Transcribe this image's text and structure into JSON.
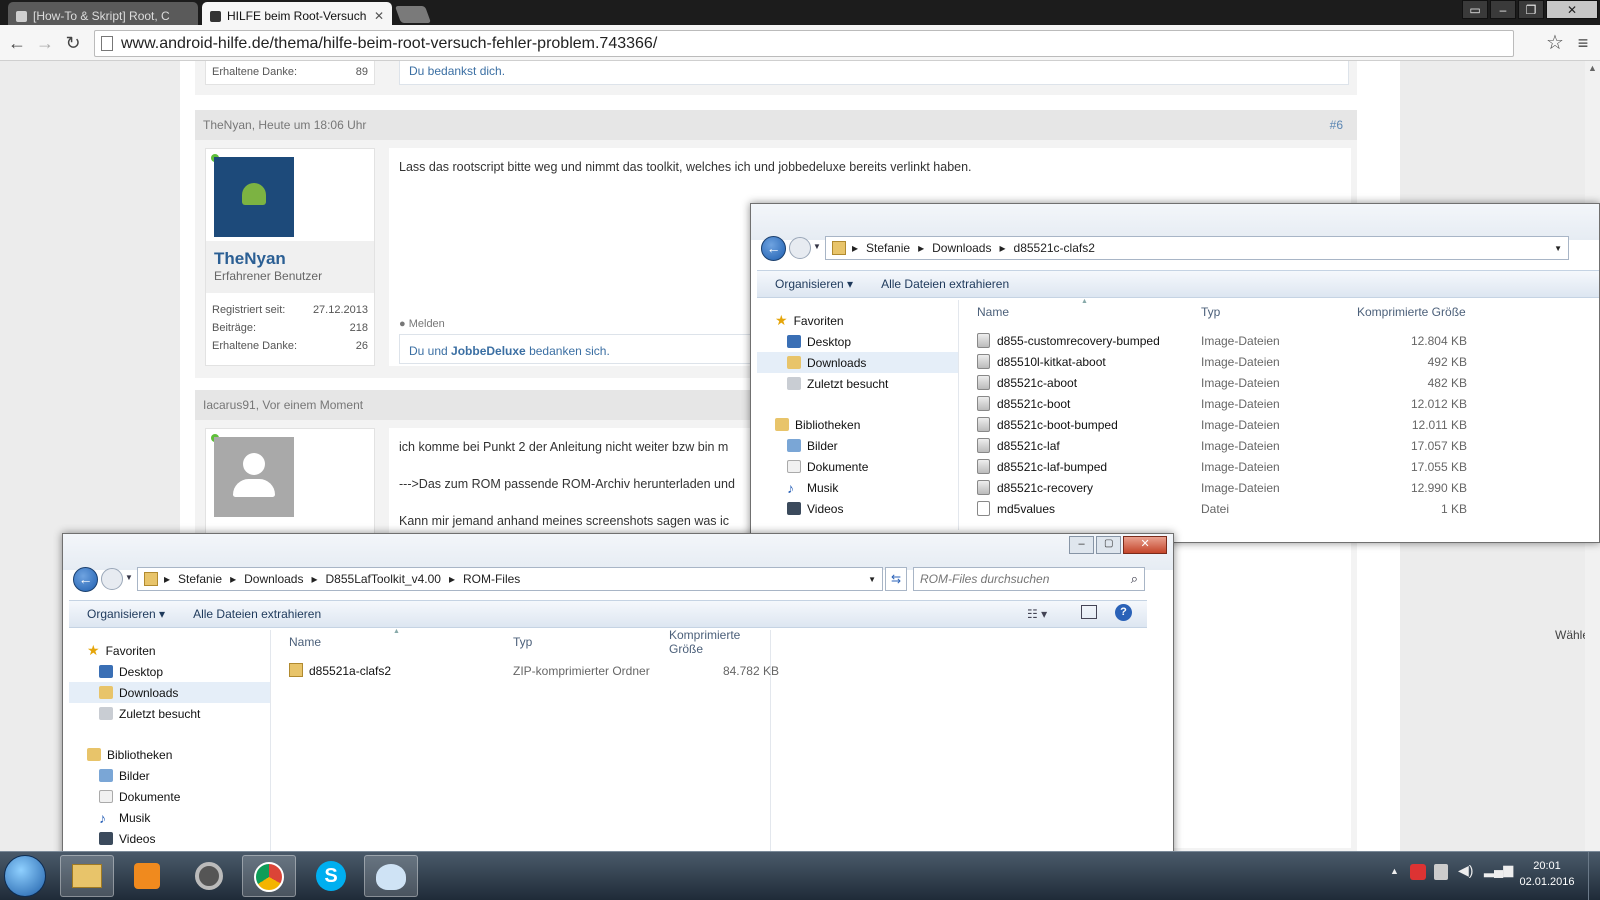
{
  "browser": {
    "tabs": [
      {
        "label": "[How-To & Skript] Root, C",
        "active": false
      },
      {
        "label": "HILFE beim Root-Versuch",
        "active": true
      }
    ],
    "url": "www.android-hilfe.de/thema/hilfe-beim-root-versuch-fehler-problem.743366/"
  },
  "forum": {
    "prev_post": {
      "thanks_label": "Erhaltene Danke:",
      "thanks_value": "89",
      "thanks_text": "Du bedankst dich."
    },
    "post6": {
      "header": "TheNyan, Heute um 18:06 Uhr",
      "number": "#6",
      "username": "TheNyan",
      "role": "Erfahrener Benutzer",
      "stats": [
        {
          "label": "Registriert seit:",
          "value": "27.12.2013"
        },
        {
          "label": "Beiträge:",
          "value": "218"
        },
        {
          "label": "Erhaltene Danke:",
          "value": "26"
        }
      ],
      "message": "Lass das rootscript bitte weg und nimmt das toolkit, welches ich und jobbedeluxe bereits verlinkt haben.",
      "report": "Melden",
      "thanks_pre": "Du und ",
      "thanks_user": "JobbeDeluxe",
      "thanks_post": " bedanken sich."
    },
    "post7": {
      "header": "Iacarus91, Vor einem Moment",
      "lines": [
        "ich komme bei Punkt 2 der Anleitung nicht weiter bzw bin m",
        "--->Das zum ROM passende ROM-Archiv herunterladen und",
        "Kann mir jemand anhand meines screenshots sagen was ic"
      ]
    },
    "side_label": "Wählen"
  },
  "explorer_back": {
    "breadcrumb": [
      "Stefanie",
      "Downloads",
      "d85521c-clafs2"
    ],
    "commands": [
      "Organisieren",
      "Alle Dateien extrahieren"
    ],
    "nav": {
      "favorites": "Favoriten",
      "fav_items": [
        "Desktop",
        "Downloads",
        "Zuletzt besucht"
      ],
      "libraries": "Bibliotheken",
      "lib_items": [
        "Bilder",
        "Dokumente",
        "Musik",
        "Videos"
      ]
    },
    "columns": [
      "Name",
      "Typ",
      "Komprimierte Größe"
    ],
    "files": [
      {
        "name": "d855-customrecovery-bumped",
        "type": "Image-Dateien",
        "size": "12.804 KB"
      },
      {
        "name": "d85510l-kitkat-aboot",
        "type": "Image-Dateien",
        "size": "492 KB"
      },
      {
        "name": "d85521c-aboot",
        "type": "Image-Dateien",
        "size": "482 KB"
      },
      {
        "name": "d85521c-boot",
        "type": "Image-Dateien",
        "size": "12.012 KB"
      },
      {
        "name": "d85521c-boot-bumped",
        "type": "Image-Dateien",
        "size": "12.011 KB"
      },
      {
        "name": "d85521c-laf",
        "type": "Image-Dateien",
        "size": "17.057 KB"
      },
      {
        "name": "d85521c-laf-bumped",
        "type": "Image-Dateien",
        "size": "17.055 KB"
      },
      {
        "name": "d85521c-recovery",
        "type": "Image-Dateien",
        "size": "12.990 KB"
      },
      {
        "name": "md5values",
        "type": "Datei",
        "size": "1 KB"
      }
    ]
  },
  "explorer_front": {
    "breadcrumb": [
      "Stefanie",
      "Downloads",
      "D855LafToolkit_v4.00",
      "ROM-Files"
    ],
    "search_placeholder": "ROM-Files durchsuchen",
    "commands": [
      "Organisieren",
      "Alle Dateien extrahieren"
    ],
    "nav": {
      "favorites": "Favoriten",
      "fav_items": [
        "Desktop",
        "Downloads",
        "Zuletzt besucht"
      ],
      "libraries": "Bibliotheken",
      "lib_items": [
        "Bilder",
        "Dokumente",
        "Musik",
        "Videos"
      ]
    },
    "columns": [
      "Name",
      "Typ",
      "Komprimierte Größe"
    ],
    "files": [
      {
        "name": "d85521a-clafs2",
        "type": "ZIP-komprimierter Ordner",
        "size": "84.782 KB"
      }
    ]
  },
  "taskbar": {
    "time": "20:01",
    "date": "02.01.2016"
  },
  "colors": {
    "accent": "#1f5fb0",
    "link": "#3b6fa3",
    "online": "#5fbf3a"
  }
}
